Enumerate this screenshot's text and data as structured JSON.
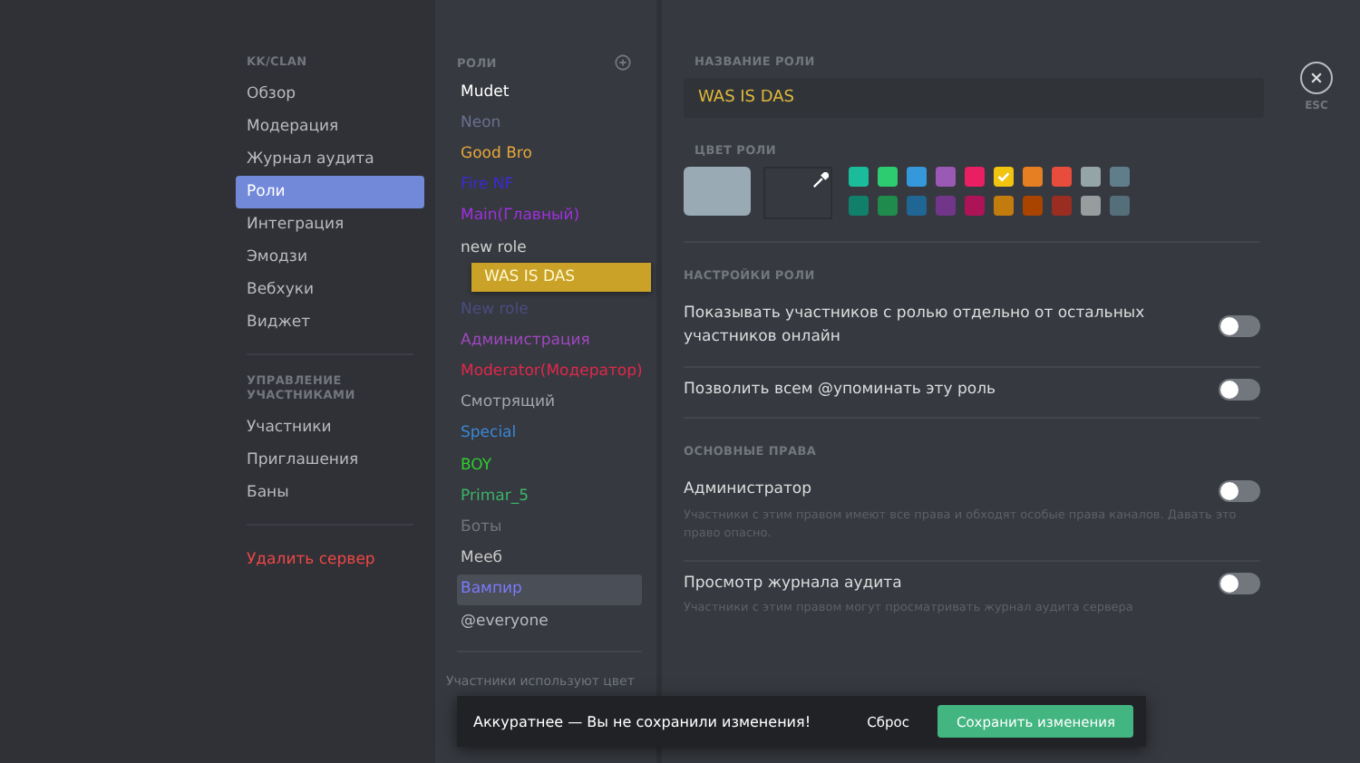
{
  "sidebar": {
    "sections": [
      {
        "heading": "KK/CLAN",
        "items": [
          {
            "label": "Обзор",
            "selected": false
          },
          {
            "label": "Модерация",
            "selected": false
          },
          {
            "label": "Журнал аудита",
            "selected": false
          },
          {
            "label": "Роли",
            "selected": true
          },
          {
            "label": "Интеграция",
            "selected": false
          },
          {
            "label": "Эмодзи",
            "selected": false
          },
          {
            "label": "Вебхуки",
            "selected": false
          },
          {
            "label": "Виджет",
            "selected": false
          }
        ]
      },
      {
        "heading": "УПРАВЛЕНИЕ УЧАСТНИКАМИ",
        "items": [
          {
            "label": "Участники",
            "selected": false
          },
          {
            "label": "Приглашения",
            "selected": false
          },
          {
            "label": "Баны",
            "selected": false
          }
        ]
      }
    ],
    "danger_item": "Удалить сервер"
  },
  "roles": {
    "heading": "РОЛИ",
    "items": [
      {
        "kind": "role",
        "name": "Mudet",
        "color": "#ffffff",
        "selected": false
      },
      {
        "kind": "role",
        "name": "Neon",
        "color": "#6a7090",
        "selected": false
      },
      {
        "kind": "role",
        "name": "Good Bro",
        "color": "#e8a83a",
        "selected": false
      },
      {
        "kind": "role",
        "name": "Fire NF",
        "color": "#3b2bd6",
        "selected": false
      },
      {
        "kind": "role",
        "name": "Main(Главный)",
        "color": "#a030e0",
        "selected": false
      },
      {
        "kind": "role",
        "name": "new role",
        "color": "#d0d0d0",
        "selected": false
      },
      {
        "kind": "dragged",
        "name": "WAS IS DAS",
        "color": "#c9a227"
      },
      {
        "kind": "role",
        "name": "New role",
        "color": "#4a4d80",
        "selected": false
      },
      {
        "kind": "role",
        "name": "Администрация",
        "color": "#a048c0",
        "selected": false
      },
      {
        "kind": "role",
        "name": "Moderator(Модератор)",
        "color": "#e0284c",
        "selected": false
      },
      {
        "kind": "role",
        "name": "Смотрящий",
        "color": "#a3a6ab",
        "selected": false
      },
      {
        "kind": "role",
        "name": "Special",
        "color": "#3a88d8",
        "selected": false
      },
      {
        "kind": "role",
        "name": "BOY",
        "color": "#2ed22e",
        "selected": false
      },
      {
        "kind": "role",
        "name": "Primar_5",
        "color": "#3cb56a",
        "selected": false
      },
      {
        "kind": "role",
        "name": "Боты",
        "color": "#72767d",
        "selected": false
      },
      {
        "kind": "role",
        "name": "Мееб",
        "color": "#c8c8c8",
        "selected": false
      },
      {
        "kind": "role",
        "name": "Вампир",
        "color": "#7b7bff",
        "selected": true
      },
      {
        "kind": "role",
        "name": "@everyone",
        "color": "#b9bbbe",
        "selected": false
      }
    ],
    "footer_hint": "Участники используют цвет"
  },
  "editor": {
    "name_label": "НАЗВАНИЕ РОЛИ",
    "name_value": "WAS IS DAS",
    "color_label": "ЦВЕТ РОЛИ",
    "swatches": [
      {
        "color": "#1abc9c",
        "selected": false
      },
      {
        "color": "#2ecc71",
        "selected": false
      },
      {
        "color": "#3498db",
        "selected": false
      },
      {
        "color": "#9b59b6",
        "selected": false
      },
      {
        "color": "#e91e63",
        "selected": false
      },
      {
        "color": "#f1c40f",
        "selected": true
      },
      {
        "color": "#e67e22",
        "selected": false
      },
      {
        "color": "#e74c3c",
        "selected": false
      },
      {
        "color": "#95a5a6",
        "selected": false
      },
      {
        "color": "#607d8b",
        "selected": false
      },
      {
        "color": "#11806a",
        "selected": false
      },
      {
        "color": "#1f8b4c",
        "selected": false
      },
      {
        "color": "#206694",
        "selected": false
      },
      {
        "color": "#71368a",
        "selected": false
      },
      {
        "color": "#ad1457",
        "selected": false
      },
      {
        "color": "#c27c0e",
        "selected": false
      },
      {
        "color": "#a84300",
        "selected": false
      },
      {
        "color": "#992d22",
        "selected": false
      },
      {
        "color": "#979c9f",
        "selected": false
      },
      {
        "color": "#546e7a",
        "selected": false
      }
    ],
    "sections": [
      {
        "heading": "НАСТРОЙКИ РОЛИ",
        "settings": [
          {
            "label": "Показывать участников с ролью отдельно от остальных участников онлайн",
            "on": false
          },
          {
            "label": "Позволить всем @упоминать эту роль",
            "on": false
          }
        ]
      },
      {
        "heading": "ОСНОВНЫЕ ПРАВА",
        "settings": [
          {
            "label": "Администратор",
            "description": "Участники с этим правом имеют все права и обходят особые права каналов. Давать это право опасно.",
            "on": false
          },
          {
            "label": "Просмотр журнала аудита",
            "description": "Участники с этим правом могут просматривать журнал аудита сервера",
            "on": false
          }
        ]
      }
    ]
  },
  "close": {
    "label": "ESC"
  },
  "notice": {
    "message": "Аккуратнее — Вы не сохранили изменения!",
    "reset": "Сброс",
    "save": "Сохранить изменения"
  }
}
